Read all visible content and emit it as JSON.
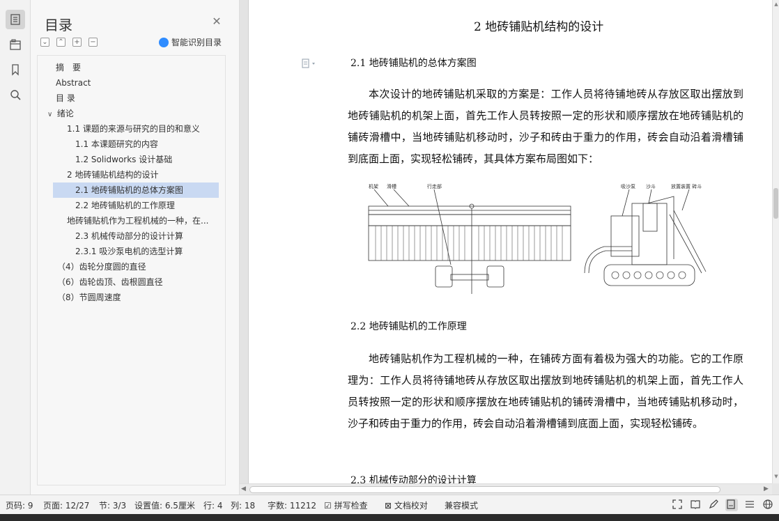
{
  "sidebar_icons": [
    "toc-icon",
    "nav-pane-icon",
    "bookmark-icon",
    "search-icon"
  ],
  "toc": {
    "title": "目录",
    "smart_label": "智能识别目录",
    "tool_expand": "⌄",
    "tool_collapse": "⌃",
    "tool_add": "+",
    "tool_remove": "−",
    "items": [
      {
        "label": "摘　要"
      },
      {
        "label": "Abstract"
      },
      {
        "label": "目 录"
      },
      {
        "label": "绪论"
      },
      {
        "label": "1.1  课题的来源与研究的目的和意义"
      },
      {
        "label": "1.1 本课题研究的内容"
      },
      {
        "label": "1.2 Solidworks 设计基础"
      },
      {
        "label": "2  地砖铺贴机结构的设计"
      },
      {
        "label": "2.1  地砖铺贴机的总体方案图"
      },
      {
        "label": "2.2  地砖铺贴机的工作原理"
      },
      {
        "label": "地砖铺贴机作为工程机械的一种，在..."
      },
      {
        "label": "2.3  机械传动部分的设计计算"
      },
      {
        "label": "2.3.1 吸沙泵电机的选型计算"
      },
      {
        "label": "（4）齿轮分度圆的直径"
      },
      {
        "label": "（6）齿轮齿顶、齿根圆直径"
      },
      {
        "label": "（8）节圆周速度"
      }
    ]
  },
  "document": {
    "heading": "2  地砖铺贴机结构的设计",
    "sec21": "2.1  地砖铺贴机的总体方案图",
    "para1": "本次设计的地砖铺贴机采取的方案是：工作人员将待铺地砖从存放区取出摆放到地砖铺贴机的机架上面，首先工作人员转按照一定的形状和顺序摆放在地砖铺贴机的铺砖滑槽中，当地砖铺贴机移动时，沙子和砖由于重力的作用，砖会自动沿着滑槽铺到底面上面，实现轻松铺砖，其具体方案布局图如下：",
    "sec22": "2.2  地砖铺贴机的工作原理",
    "para2": "地砖铺贴机作为工程机械的一种，在铺砖方面有着极为强大的功能。它的工作原理为：工作人员将待铺地砖从存放区取出摆放到地砖铺贴机的机架上面，首先工作人员转按照一定的形状和顺序摆放在地砖铺贴机的铺砖滑槽中，当地砖铺贴机移动时，沙子和砖由于重力的作用，砖会自动沿着滑槽铺到底面上面，实现轻松铺砖。",
    "sec23": "2.3  机械传动部分的设计计算",
    "figure_labels": [
      "机架",
      "滑槽",
      "行走部",
      "吸沙泵",
      "沙斗",
      "放置装置 砖斗"
    ]
  },
  "status": {
    "pages_count": "页码: 9",
    "page": "页面: 12/27",
    "section": "节: 3/3",
    "setting": "设置值: 6.5厘米",
    "row": "行: 4",
    "col": "列: 18",
    "words": "字数: 11212",
    "spellcheck": "拼写检查",
    "proofread": "文档校对",
    "compat": "兼容模式"
  }
}
